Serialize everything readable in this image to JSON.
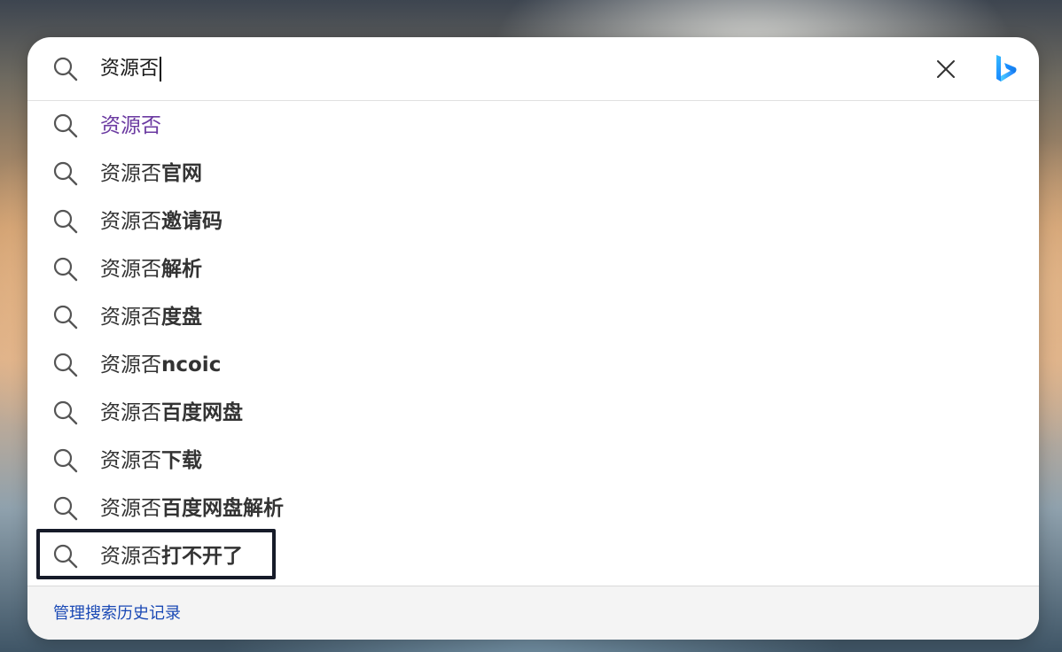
{
  "search": {
    "query": "资源否",
    "search_icon": "search-icon",
    "clear_icon": "close-icon",
    "logo": "bing-logo"
  },
  "suggestions": [
    {
      "prefix": "资源否",
      "completion": "",
      "visited": true
    },
    {
      "prefix": "资源否",
      "completion": "官网",
      "visited": false
    },
    {
      "prefix": "资源否",
      "completion": "邀请码",
      "visited": false
    },
    {
      "prefix": "资源否",
      "completion": "解析",
      "visited": false
    },
    {
      "prefix": "资源否",
      "completion": "度盘",
      "visited": false
    },
    {
      "prefix": "资源否",
      "completion": "ncoic",
      "visited": false
    },
    {
      "prefix": "资源否",
      "completion": "百度网盘",
      "visited": false
    },
    {
      "prefix": "资源否",
      "completion": "下载",
      "visited": false
    },
    {
      "prefix": "资源否",
      "completion": "百度网盘解析",
      "visited": false
    },
    {
      "prefix": "资源否",
      "completion": "打不开了",
      "visited": false
    }
  ],
  "highlighted_suggestion_index": 9,
  "footer": {
    "manage_history_label": "管理搜索历史记录"
  },
  "colors": {
    "visited_text": "#6b3aa1",
    "link": "#1a49b5",
    "highlight_border": "#161b29"
  }
}
